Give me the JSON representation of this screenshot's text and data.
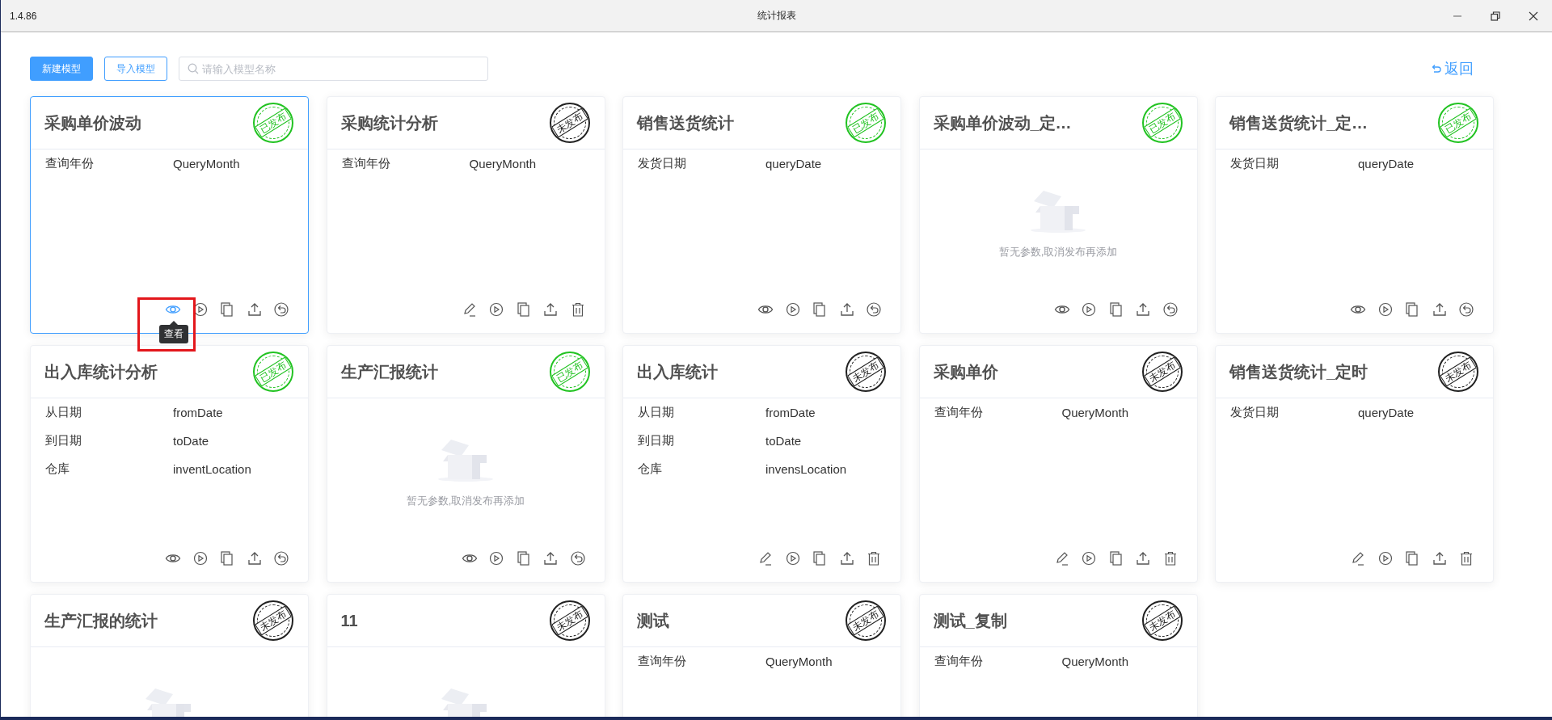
{
  "window": {
    "version": "1.4.86",
    "title": "统计报表"
  },
  "toolbar": {
    "new_button": "新建模型",
    "import_button": "导入模型",
    "search": {
      "placeholder": "请输入模型名称"
    },
    "back_link": "返回"
  },
  "cards": [
    {
      "title": "采购单价波动",
      "published": true,
      "stamp": "已发布",
      "hovered": true,
      "tooltip": "查看",
      "highlighted": true,
      "kind": "params",
      "params": [
        {
          "label": "查询年份",
          "value": "QueryMonth"
        }
      ]
    },
    {
      "title": "采购统计分析",
      "published": false,
      "stamp": "未发布",
      "kind": "params",
      "params": [
        {
          "label": "查询年份",
          "value": "QueryMonth"
        }
      ]
    },
    {
      "title": "销售送货统计",
      "published": true,
      "stamp": "已发布",
      "kind": "params",
      "params": [
        {
          "label": "发货日期",
          "value": "queryDate"
        }
      ]
    },
    {
      "title": "采购单价波动_定…",
      "published": true,
      "stamp": "已发布",
      "kind": "empty",
      "empty_text": "暂无参数,取消发布再添加"
    },
    {
      "title": "销售送货统计_定…",
      "published": true,
      "stamp": "已发布",
      "kind": "params",
      "params": [
        {
          "label": "发货日期",
          "value": "queryDate"
        }
      ]
    },
    {
      "title": "出入库统计分析",
      "published": true,
      "stamp": "已发布",
      "kind": "params",
      "params": [
        {
          "label": "从日期",
          "value": "fromDate"
        },
        {
          "label": "到日期",
          "value": "toDate"
        },
        {
          "label": "仓库",
          "value": "inventLocation"
        }
      ]
    },
    {
      "title": "生产汇报统计",
      "published": true,
      "stamp": "已发布",
      "kind": "empty",
      "empty_text": "暂无参数,取消发布再添加"
    },
    {
      "title": "出入库统计",
      "published": false,
      "stamp": "未发布",
      "kind": "params",
      "params": [
        {
          "label": "从日期",
          "value": "fromDate"
        },
        {
          "label": "到日期",
          "value": "toDate"
        },
        {
          "label": "仓库",
          "value": "invensLocation"
        }
      ]
    },
    {
      "title": "采购单价",
      "published": false,
      "stamp": "未发布",
      "kind": "params",
      "params": [
        {
          "label": "查询年份",
          "value": "QueryMonth"
        }
      ]
    },
    {
      "title": "销售送货统计_定时",
      "published": false,
      "stamp": "未发布",
      "kind": "params",
      "params": [
        {
          "label": "发货日期",
          "value": "queryDate"
        }
      ]
    },
    {
      "title": "生产汇报的统计",
      "published": false,
      "stamp": "未发布",
      "kind": "empty",
      "cut_off": true
    },
    {
      "title": "11",
      "published": false,
      "stamp": "未发布",
      "kind": "empty",
      "cut_off": true
    },
    {
      "title": "测试",
      "published": false,
      "stamp": "未发布",
      "kind": "params",
      "cut_off": true,
      "params": [
        {
          "label": "查询年份",
          "value": "QueryMonth"
        }
      ]
    },
    {
      "title": "测试_复制",
      "published": false,
      "stamp": "未发布",
      "kind": "params",
      "cut_off": true,
      "params": [
        {
          "label": "查询年份",
          "value": "QueryMonth"
        }
      ]
    }
  ]
}
